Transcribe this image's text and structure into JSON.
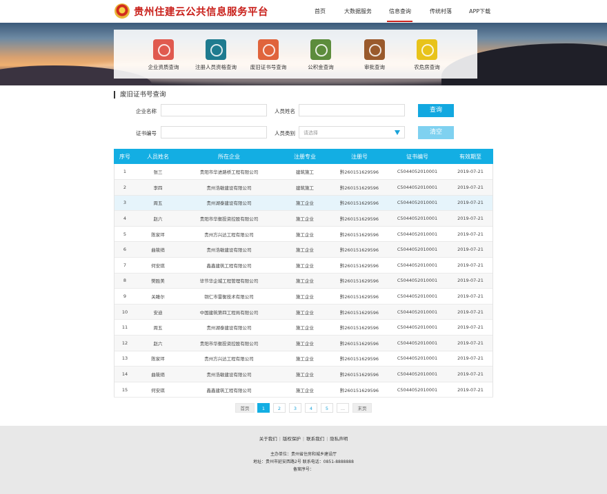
{
  "header": {
    "site_title": "贵州住建云公共信息服务平台",
    "nav": [
      "首页",
      "大数据服务",
      "信息查询",
      "传统村落",
      "APP下载"
    ],
    "active_nav": "信息查询"
  },
  "quick_links": [
    {
      "label": "企业资质查询",
      "icon": "enterprise-cert-icon",
      "color": "#e05a4f"
    },
    {
      "label": "注册人员资格查询",
      "icon": "registered-staff-icon",
      "color": "#1f7b8f"
    },
    {
      "label": "废旧证书号查询",
      "icon": "old-cert-icon",
      "color": "#e0643c"
    },
    {
      "label": "公积金查询",
      "icon": "provident-fund-icon",
      "color": "#5c8c3c"
    },
    {
      "label": "审批查询",
      "icon": "approval-icon",
      "color": "#9a5a2c"
    },
    {
      "label": "农危房查询",
      "icon": "rural-house-icon",
      "color": "#e8c31a"
    }
  ],
  "section_title": "废旧证书号查询",
  "form": {
    "company_label": "企业名称",
    "person_label": "人员姓名",
    "cert_label": "证书编号",
    "category_label": "人员类别",
    "category_placeholder": "请选择",
    "query_button": "查询",
    "clear_button": "清空"
  },
  "table": {
    "headers": [
      "序号",
      "人员姓名",
      "所在企业",
      "注册专业",
      "注册号",
      "证书编号",
      "有效期至"
    ],
    "rows": [
      [
        "1",
        "张三",
        "贵阳市华进路桥工程有限公司",
        "建筑施工",
        "黔260151629596",
        "C5044052010001",
        "2019-07-21"
      ],
      [
        "2",
        "李四",
        "贵州浩敏建设有限公司",
        "建筑施工",
        "黔260151629596",
        "C5044052010001",
        "2019-07-21"
      ],
      [
        "3",
        "周五",
        "贵州湖泰建设有限公司",
        "施工企业",
        "黔260151629596",
        "C5044052010001",
        "2019-07-21"
      ],
      [
        "4",
        "赵六",
        "贵阳市华衡投资控股有限公司",
        "施工企业",
        "黔260151629596",
        "C5044052010001",
        "2019-07-21"
      ],
      [
        "5",
        "陈家坪",
        "贵州方兴达工程有限公司",
        "施工企业",
        "黔260151629596",
        "C5044052010001",
        "2019-07-21"
      ],
      [
        "6",
        "曲筱绡",
        "贵州浩敏建设有限公司",
        "施工企业",
        "黔260151629596",
        "C5044052010001",
        "2019-07-21"
      ],
      [
        "7",
        "何安琪",
        "鑫鑫建筑工程有限公司",
        "施工企业",
        "黔260151629596",
        "C5044052010001",
        "2019-07-21"
      ],
      [
        "8",
        "樊胜美",
        "毕节华企城工程管理有限公司",
        "施工企业",
        "黔260151629596",
        "C5044052010001",
        "2019-07-21"
      ],
      [
        "9",
        "关雎尔",
        "铜仁市雷衡技术有限公司",
        "施工企业",
        "黔260151629596",
        "C5044052010001",
        "2019-07-21"
      ],
      [
        "10",
        "安迪",
        "中国建筑第四工程局有限公司",
        "施工企业",
        "黔260151629596",
        "C5044052010001",
        "2019-07-21"
      ],
      [
        "11",
        "周五",
        "贵州湖泰建设有限公司",
        "施工企业",
        "黔260151629596",
        "C5044052010001",
        "2019-07-21"
      ],
      [
        "12",
        "赵六",
        "贵阳市华衡投资控股有限公司",
        "施工企业",
        "黔260151629596",
        "C5044052010001",
        "2019-07-21"
      ],
      [
        "13",
        "陈家坪",
        "贵州方兴达工程有限公司",
        "施工企业",
        "黔260151629596",
        "C5044052010001",
        "2019-07-21"
      ],
      [
        "14",
        "曲筱绡",
        "贵州浩敏建设有限公司",
        "施工企业",
        "黔260151629596",
        "C5044052010001",
        "2019-07-21"
      ],
      [
        "15",
        "何安琪",
        "鑫鑫建筑工程有限公司",
        "施工企业",
        "黔260151629596",
        "C5044052010001",
        "2019-07-21"
      ]
    ]
  },
  "pagination": {
    "first": "首页",
    "pages": [
      "1",
      "2",
      "3",
      "4",
      "5"
    ],
    "ellipsis": "...",
    "last": "末页",
    "current": "1"
  },
  "footer": {
    "links": [
      "关于我们",
      "版权保护",
      "联系我们",
      "隐私声明"
    ],
    "host": "主办单位：贵州省住房和城乡建设厅",
    "address": "地址：贵州市延安西路2号  联系电话：0851-8888888",
    "icp": "备案序号："
  }
}
